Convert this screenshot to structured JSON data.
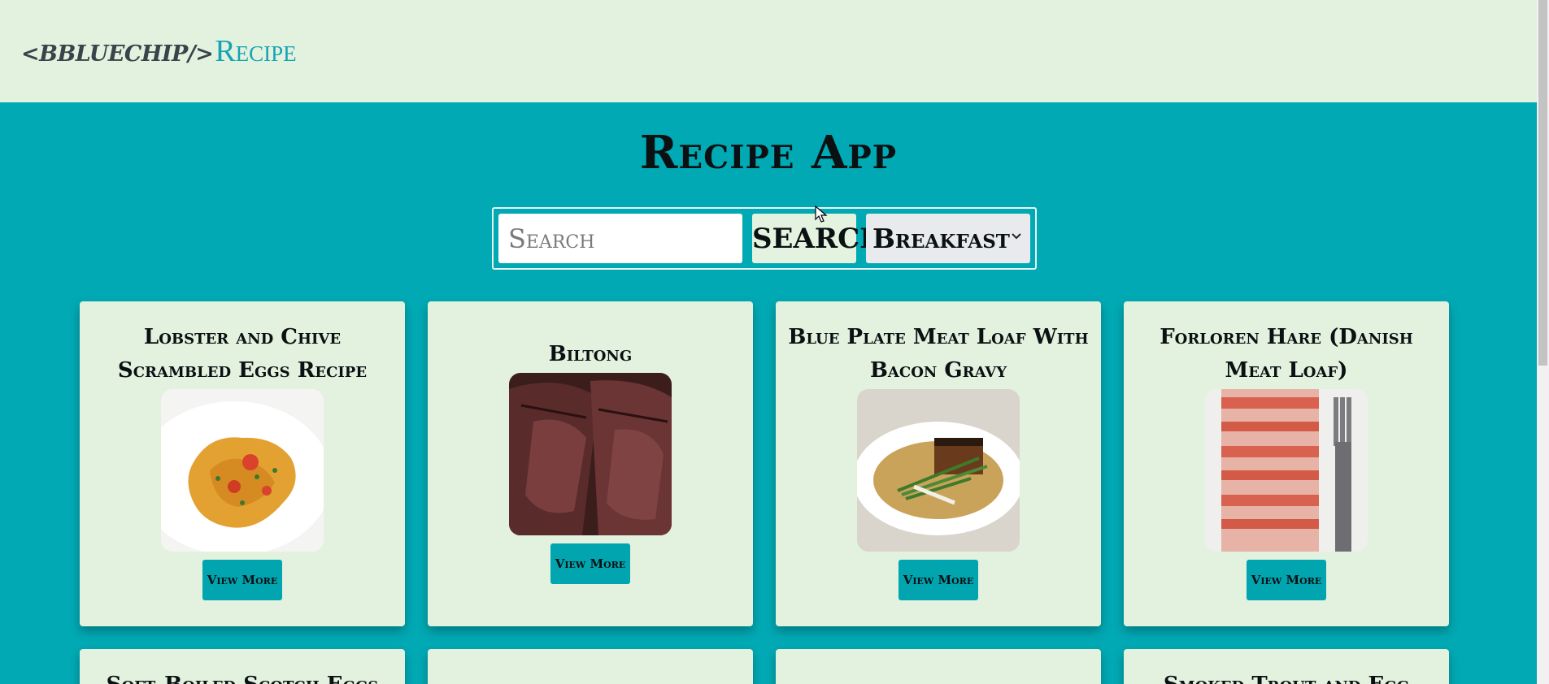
{
  "header": {
    "brand_code_open": "<BBLUECHIP",
    "brand_code_close": "/>",
    "brand_name": "Recipe"
  },
  "main": {
    "title": "Recipe App",
    "search": {
      "placeholder": "Search",
      "value": "",
      "button_label": "SEARCH",
      "category_selected": "Breakfast"
    }
  },
  "recipes": [
    {
      "title": "Lobster and Chive Scrambled Eggs Recipe",
      "button_label": "View More",
      "image": "scrambled-eggs-image"
    },
    {
      "title": "Biltong",
      "button_label": "View More",
      "image": "biltong-image"
    },
    {
      "title": "Blue Plate Meat Loaf With Bacon Gravy",
      "button_label": "View More",
      "image": "meat-loaf-image"
    },
    {
      "title": "Forloren Hare (Danish Meat Loaf)",
      "button_label": "View More",
      "image": "bacon-meat-loaf-image"
    },
    {
      "title": "Soft-Boiled Scotch Eggs"
    },
    {
      "title": ""
    },
    {
      "title": ""
    },
    {
      "title": "Smoked Trout and Egg"
    }
  ],
  "colors": {
    "background": "#00a9b4",
    "header": "#e3f1df",
    "card": "#e3f1df",
    "accent": "#00a5b0",
    "brand": "#16a4b5"
  }
}
